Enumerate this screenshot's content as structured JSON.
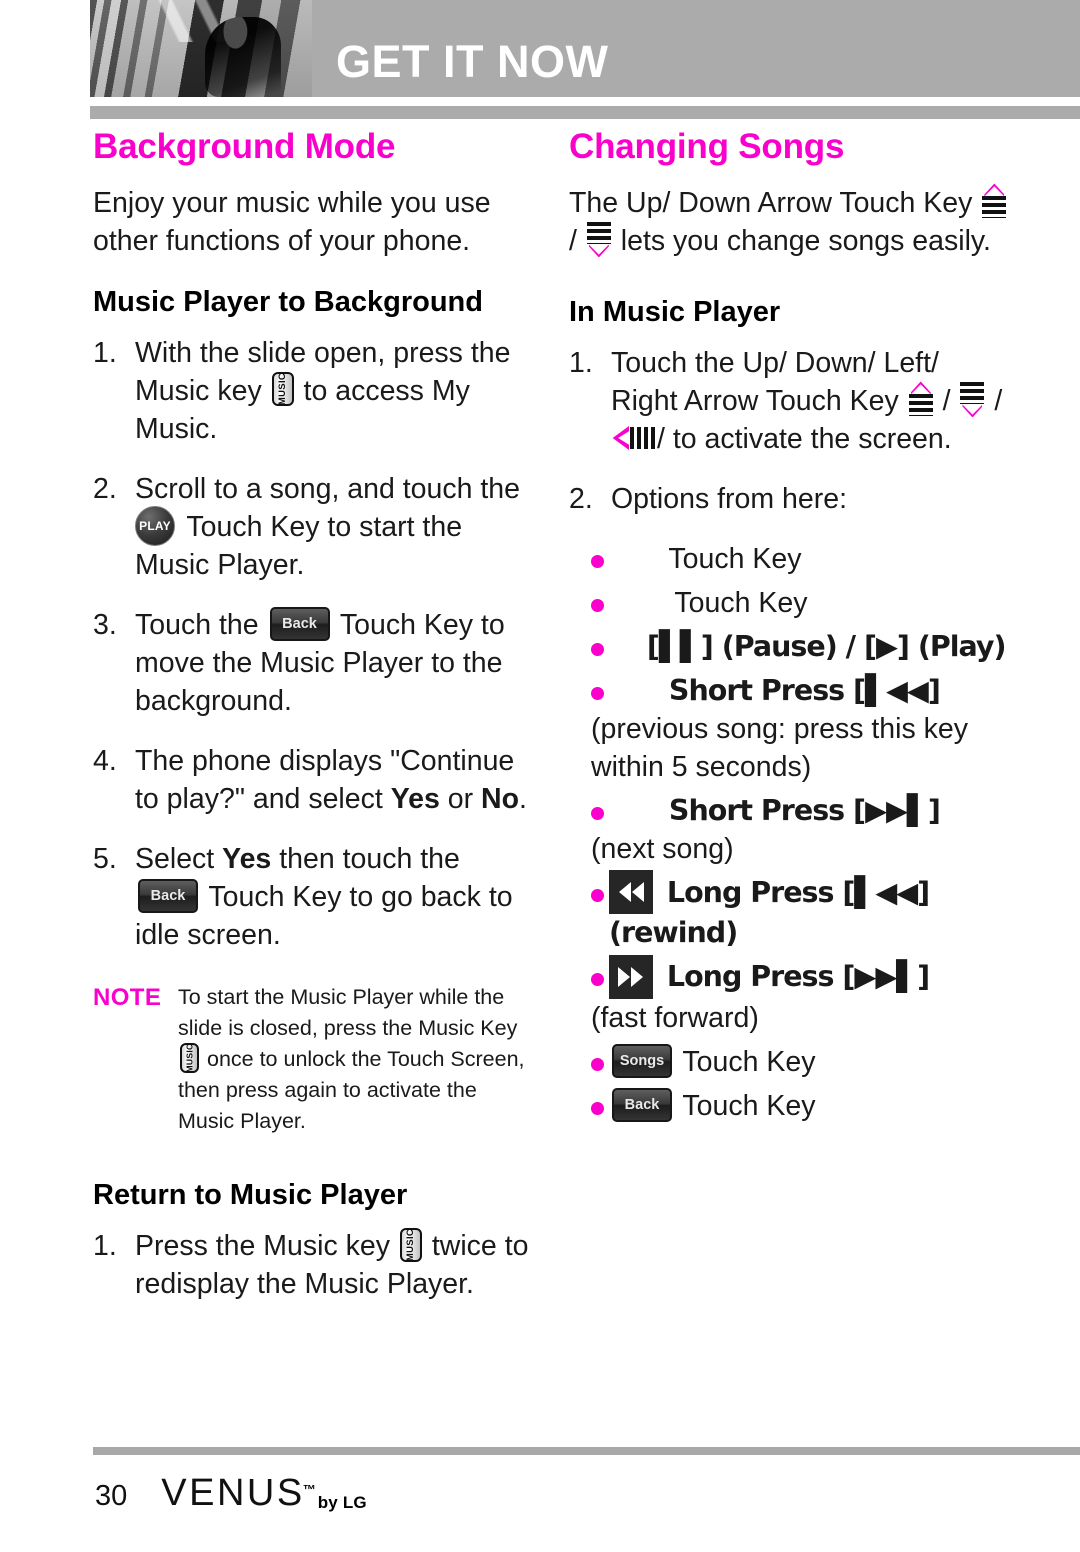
{
  "header": {
    "title": "GET IT NOW",
    "photo_alt": "black-and-white lifestyle photo"
  },
  "left_column": {
    "section_title": "Background Mode",
    "intro": "Enjoy your music while you use other functions of your phone.",
    "sub1_title": "Music Player to Background",
    "steps": [
      {
        "num": "1.",
        "part1": "With the slide open, press the Music key",
        "icon": "music-key-icon",
        "icon_label": "MUSIC",
        "part2": "to access My Music."
      },
      {
        "num": "2.",
        "part1": "Scroll to a song, and touch the",
        "icon": "play-touch-key-icon",
        "icon_label": "PLAY",
        "part2": "Touch Key to start the Music Player."
      },
      {
        "num": "3.",
        "part1": "Touch the",
        "icon": "back-touch-key-icon",
        "icon_label": "Back",
        "part2": "Touch Key to move the Music Player to the background."
      },
      {
        "num": "4.",
        "part1": "The phone displays \"Continue to play?\" and select",
        "bold1": "Yes",
        "mid": "or",
        "bold2": "No",
        "part2": "."
      },
      {
        "num": "5.",
        "part1": "Select",
        "bold1": "Yes",
        "mid": "then touch the",
        "icon": "back-touch-key-icon",
        "icon_label": "Back",
        "part2": "Touch Key to go back to idle screen."
      }
    ],
    "note": {
      "label": "NOTE",
      "text1": "To start the Music Player while the slide is closed, press the Music Key",
      "icon": "music-key-icon",
      "icon_label": "MUSIC",
      "text2": "once to unlock the Touch Screen, then press again to activate the Music Player."
    },
    "sub2_title": "Return to Music Player",
    "steps2": [
      {
        "num": "1.",
        "part1": "Press the Music key",
        "icon": "music-key-icon",
        "icon_label": "MUSIC",
        "part2": "twice to redisplay the Music Player."
      }
    ]
  },
  "right_column": {
    "section_title": "Changing Songs",
    "intro_part1": "The Up/ Down Arrow Touch Key",
    "intro_icon_up": "arrow-up-touch-key-icon",
    "intro_slash": "/",
    "intro_icon_down": "arrow-down-touch-key-icon",
    "intro_part2": "lets you change songs easily.",
    "sub_title": "In Music Player",
    "steps": [
      {
        "num": "1.",
        "part1": "Touch the Up/ Down/ Left/ Right Arrow Touch Key",
        "icons": [
          "arrow-up-touch-key-icon",
          "arrow-down-touch-key-icon",
          "arrow-left-touch-key-icon"
        ],
        "part2": "to activate the screen."
      },
      {
        "num": "2.",
        "part1": "Options from here:"
      }
    ],
    "options": [
      {
        "icon": "",
        "label": "Touch Key",
        "indent": "wide"
      },
      {
        "icon": "",
        "label": "Touch Key",
        "indent": "medium"
      },
      {
        "icon": "",
        "label": "[▌▌] (Pause) / [▶] (Play)",
        "indent": "small"
      },
      {
        "icon": "",
        "label": "Short Press [▌◀◀]",
        "indent": "medium",
        "sub": "(previous song: press this key within 5 seconds)"
      },
      {
        "icon": "",
        "label": "Short Press [▶▶▌]",
        "indent": "medium",
        "sub": "(next song)"
      },
      {
        "icon": "rewind-button-icon",
        "label": "Long Press [▌◀◀] (rewind)",
        "indent": "none"
      },
      {
        "icon": "fast-forward-button-icon",
        "label": "Long Press [▶▶▌]",
        "indent": "none",
        "sub": "(fast forward)"
      },
      {
        "icon": "songs-touch-key-icon",
        "icon_label": "Songs",
        "label": "Touch Key",
        "indent": "none"
      },
      {
        "icon": "back-touch-key-icon",
        "icon_label": "Back",
        "label": "Touch Key",
        "indent": "none"
      }
    ]
  },
  "footer": {
    "page_number": "30",
    "logo_name": "VENUS",
    "logo_tm": "™",
    "logo_by": "by LG"
  },
  "colors": {
    "magenta": "#f900cc",
    "header_gray": "#ababab",
    "text": "#1a1a1a",
    "key_dark": "#262626"
  }
}
